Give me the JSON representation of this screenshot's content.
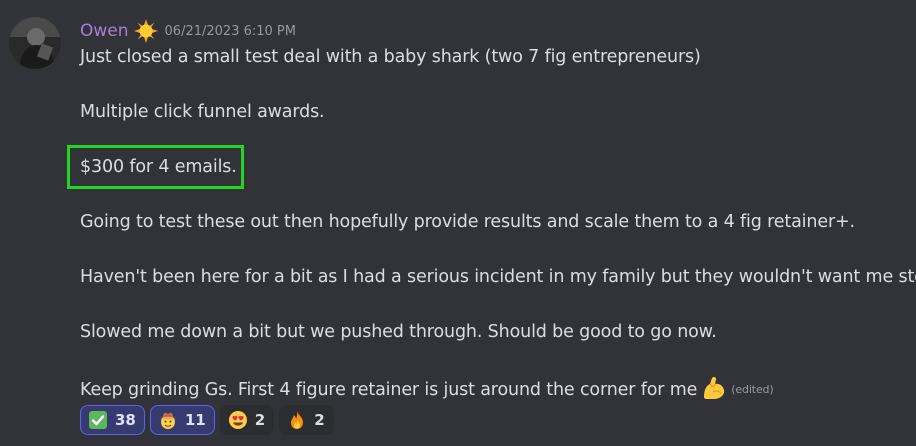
{
  "author": {
    "name": "Owen",
    "role_icon": "sun-icon",
    "timestamp": "06/21/2023 6:10 PM"
  },
  "message": {
    "lines": [
      "Just closed a small test deal with a baby shark (two 7 fig entrepreneurs)",
      "Multiple click funnel awards.",
      "$300 for 4 emails.",
      "Going to test these out then hopefully provide results and scale them to a 4 fig retainer+.",
      "Haven't been here for a bit as I had a serious incident in my family but they wouldn't want me stop.",
      "Slowed me down a bit but we pushed through. Should be good to go now.",
      "Keep grinding Gs. First 4 figure retainer is just around the corner for me"
    ],
    "trailing_emoji": "flexed-biceps-icon",
    "edited_label": "(edited)",
    "highlight_color": "#22d51f"
  },
  "reactions": [
    {
      "emoji": "check-mark-icon",
      "count": "38",
      "active": true
    },
    {
      "emoji": "cowboy-face-icon",
      "count": "11",
      "active": true
    },
    {
      "emoji": "heart-eyes-face-icon",
      "count": "2",
      "active": false
    },
    {
      "emoji": "fire-icon",
      "count": "2",
      "active": false
    }
  ],
  "colors": {
    "background": "#313338",
    "username": "#a97ed6",
    "text": "#dbdee1",
    "muted": "#949ba4",
    "reaction_active_border": "#5865f2"
  }
}
